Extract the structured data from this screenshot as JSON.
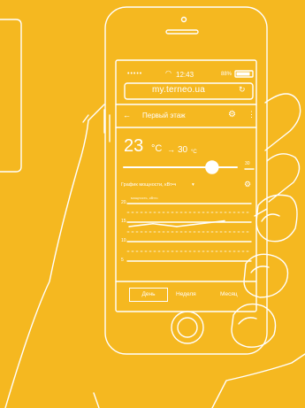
{
  "status": {
    "dots": "•••••",
    "time": "12:43",
    "battery": "88%"
  },
  "browser": {
    "url": "my.terneo.ua"
  },
  "header": {
    "title": "Первый этаж"
  },
  "thermostat": {
    "current_temp": "23",
    "current_unit": "°C",
    "arrow": "→",
    "target_temp": "30",
    "target_unit": "°C",
    "slider_max": "30",
    "slider_level": 0.78
  },
  "chart": {
    "title": "График мощности, кВт•ч",
    "unit_label": "мощность, кВт•ч",
    "y_ticks": [
      "20",
      "15",
      "10",
      "5",
      "0"
    ]
  },
  "chart_data": {
    "type": "line",
    "title": "График мощности, кВт•ч",
    "ylabel": "мощность, кВт•ч",
    "ylim": [
      0,
      20
    ],
    "series": [
      {
        "values": [
          12,
          13,
          12,
          13,
          14
        ]
      }
    ]
  },
  "tabs": {
    "day": "День",
    "week": "Неделя",
    "month": "Месяц",
    "active": "day"
  },
  "colors": {
    "background": "#F5B820",
    "line": "#FFFFFF"
  }
}
